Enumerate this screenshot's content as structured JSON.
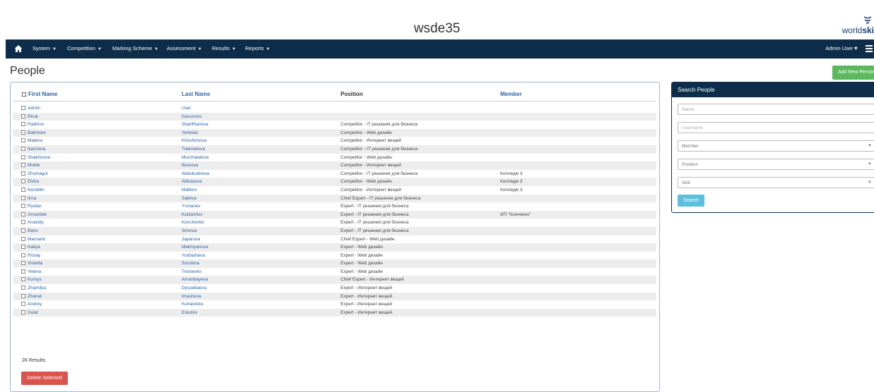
{
  "site_title": "wsde35",
  "logo": {
    "part1": "world",
    "part2": "ski"
  },
  "nav": {
    "items": [
      "System",
      "Competition",
      "Marking Scheme",
      "Assessment",
      "Results",
      "Reports"
    ],
    "user": "Admin User"
  },
  "page": {
    "title": "People",
    "add_button": "Add New Person"
  },
  "table": {
    "headers": {
      "first": "First Name",
      "last": "Last Name",
      "position": "Position",
      "member": "Member"
    },
    "rows": [
      {
        "first": "Admin",
        "last": "User",
        "position": "",
        "member": ""
      },
      {
        "first": "Rinat",
        "last": "Gassimov",
        "position": "",
        "member": ""
      },
      {
        "first": "Raikhon",
        "last": "Sharifhanova",
        "position": "Competitor - IT решения для бизнеса",
        "member": ""
      },
      {
        "first": "Bakhtore",
        "last": "Yerbolat",
        "position": "Competitor - Web дизайн",
        "member": ""
      },
      {
        "first": "Madina",
        "last": "Khoshimova",
        "position": "Competitor - Интернет вещей",
        "member": ""
      },
      {
        "first": "Nazmina",
        "last": "Tulemetova",
        "position": "Competitor - IT решения для бизнеса",
        "member": ""
      },
      {
        "first": "Shakhnoza",
        "last": "Murzhatalova",
        "position": "Competitor - Web дизайн",
        "member": ""
      },
      {
        "first": "Molde",
        "last": "Ilessova",
        "position": "Competitor - Интернет вещей",
        "member": ""
      },
      {
        "first": "Zhumagul",
        "last": "Abdukodirova",
        "position": "Competitor - IT решения для бизнеса",
        "member": "Колледж 3"
      },
      {
        "first": "Elvira",
        "last": "Abbasova",
        "position": "Competitor - Web дизайн",
        "member": "Колледж 3"
      },
      {
        "first": "Nuriddin",
        "last": "Malikov",
        "position": "Competitor - Интернет вещей",
        "member": "Колледж 3"
      },
      {
        "first": "Irina",
        "last": "Salieva",
        "position": "Chief Expert - IT решения для бизнеса",
        "member": ""
      },
      {
        "first": "Ryslan",
        "last": "Ysmanov",
        "position": "Expert - IT решения для бизнеса",
        "member": ""
      },
      {
        "first": "Anvarbek",
        "last": "Kuldashev",
        "position": "Expert - IT решения для бизнеса",
        "member": "ИП \"Конченко\""
      },
      {
        "first": "Anatoliy",
        "last": "Konchenko",
        "position": "Expert - IT решения для бизнеса",
        "member": ""
      },
      {
        "first": "Banu",
        "last": "Simova",
        "position": "Expert - IT решения для бизнеса",
        "member": ""
      },
      {
        "first": "Marvarid",
        "last": "Japarova",
        "position": "Chief Expert - Web дизайн",
        "member": ""
      },
      {
        "first": "Nailya",
        "last": "Makhiyanova",
        "position": "Expert - Web дизайн",
        "member": ""
      },
      {
        "first": "Rozay",
        "last": "Yuldasheva",
        "position": "Expert - Web дизайн",
        "member": ""
      },
      {
        "first": "Violetta",
        "last": "Sorokina",
        "position": "Expert - Web дизайн",
        "member": ""
      },
      {
        "first": "Yelena",
        "last": "Trotsenko",
        "position": "Expert - Web дизайн",
        "member": ""
      },
      {
        "first": "Kumys",
        "last": "Amanbayeva",
        "position": "Chief Expert - Интернет вещей",
        "member": ""
      },
      {
        "first": "Zhamilya",
        "last": "Dyssebaeva",
        "position": "Expert - Интернет вещей",
        "member": ""
      },
      {
        "first": "Zhanat",
        "last": "Imasheva",
        "position": "Expert - Интернет вещей",
        "member": ""
      },
      {
        "first": "Andrey",
        "last": "Kurtanidze",
        "position": "Expert - Интернет вещей",
        "member": ""
      },
      {
        "first": "Dulat",
        "last": "Eskulov",
        "position": "Expert - Интернет вещей",
        "member": ""
      }
    ],
    "results": "26 Results",
    "delete_button": "Delete Selected"
  },
  "search": {
    "title": "Search People",
    "name_placeholder": "Name",
    "username_placeholder": "Username",
    "member_select": "Member",
    "position_select": "Position",
    "skill_select": "Skill",
    "button": "Search"
  }
}
